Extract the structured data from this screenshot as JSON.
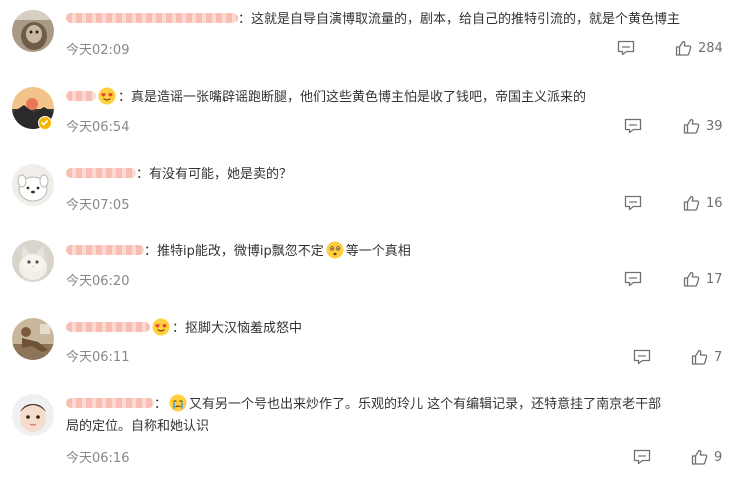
{
  "comments": [
    {
      "text": "这就是自导自演博取流量的，剧本，给自己的推特引流的，就是个黄色博主",
      "time": "今天02:09",
      "likes": "284",
      "avatar_icon": "monkey-photo-avatar",
      "name_redacted": true
    },
    {
      "text": "真是造谣一张嘴辟谣跑断腿，他们这些黄色博主怕是收了钱吧，帝国主义派来的",
      "time": "今天06:54",
      "likes": "39",
      "avatar_icon": "landscape-photo-avatar",
      "verified": true,
      "name_badge_icon": "heart-eyes-emoji-icon",
      "name_redacted": true
    },
    {
      "text": "有没有可能，她是卖的？",
      "time": "今天07:05",
      "likes": "16",
      "avatar_icon": "cartoon-dog-avatar",
      "name_redacted": true
    },
    {
      "text_before": "推特ip能改，微博ip飘忽不定",
      "inline_emoji": "thinking-emoji-icon",
      "text_after": "等一个真相",
      "time": "今天06:20",
      "likes": "17",
      "avatar_icon": "cat-photo-avatar",
      "name_redacted": true
    },
    {
      "text": "抠脚大汉恼羞成怒中",
      "time": "今天06:11",
      "likes": "7",
      "avatar_icon": "person-photo-avatar",
      "name_badge_icon": "heart-eyes-emoji-icon",
      "name_redacted": true
    },
    {
      "inline_emoji": "crying-emoji-icon",
      "text_line1": "又有另一个号也出来炒作了。乐观的玲儿 这个有编辑记录，还特意挂了南京老干部",
      "text_line2": "局的定位。自称和她认识",
      "time": "今天06:16",
      "likes": "9",
      "avatar_icon": "baby-photo-avatar",
      "name_redacted": true
    }
  ],
  "separator": "：",
  "colors": {
    "text": "#333333",
    "meta": "#888888",
    "icon": "#707070",
    "redaction": "#f7b2a6",
    "verified_badge": "#f5b400"
  }
}
